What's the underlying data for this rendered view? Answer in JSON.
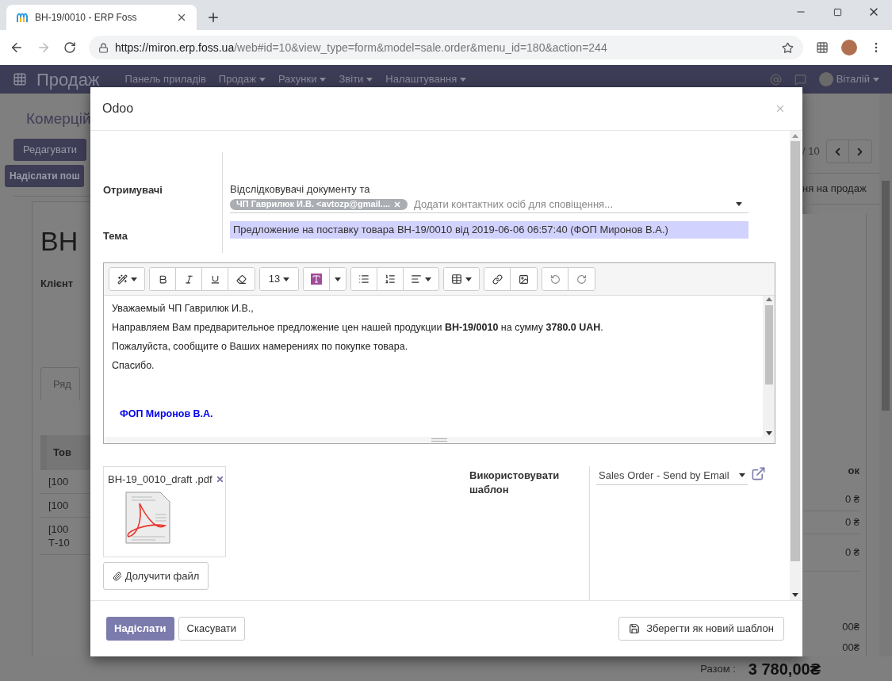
{
  "browser": {
    "tab_title": "ВН-19/0010 - ERP Foss",
    "url_host": "https://miron.erp.foss.ua",
    "url_path": "/web#id=10&view_type=form&model=sale.order&menu_id=180&action=244"
  },
  "navbar": {
    "app": "Продаж",
    "menu": [
      {
        "label": "Панель приладів",
        "has_menu": false
      },
      {
        "label": "Продаж",
        "has_menu": true
      },
      {
        "label": "Рахунки",
        "has_menu": true
      },
      {
        "label": "Звіти",
        "has_menu": true
      },
      {
        "label": "Налаштування",
        "has_menu": true
      }
    ],
    "user": "Віталій"
  },
  "background": {
    "breadcrumb": "Комерцій",
    "edit_button": "Редагувати",
    "send_button": "Надіслати пош",
    "pager": "/ 10",
    "status": "ня на продаж",
    "record_title": "ВН",
    "customer_label": "Клієнт",
    "tab": "Ряд",
    "col_left": "Тов",
    "col_right": "ок",
    "rows": [
      {
        "left": [
          "[100"
        ],
        "right": "0 ₴"
      },
      {
        "left": [
          "[100"
        ],
        "right": "0 ₴"
      },
      {
        "left": [
          "[100",
          "Т-10"
        ],
        "right": "0 ₴"
      }
    ],
    "subtotals": [
      "00₴",
      "00₴"
    ],
    "total_label": "Разом :",
    "total_value": "3 780,00₴"
  },
  "dialog": {
    "title": "Odoo",
    "recipients_label": "Отримувачі",
    "recipients_text": "Відслідковувачі документу та",
    "recipient_tags": [
      "ЧП Гаврилюк И.В. <avtozp@gmail...."
    ],
    "recipients_placeholder": "Додати контактних осіб для сповіщення...",
    "subject_label": "Тема",
    "subject": "Предложение на поставку товара ВН-19/0010 від 2019-06-06 06:57:40 (ФОП Миронов В.А.)",
    "font_size": "13",
    "body": [
      "Уважаемый ЧП Гаврилюк И.В.,",
      "Направляем Вам предварительное предложение цен нашей продукции **ВН-19/0010** на сумму **3780.0 UAH**.",
      "Пожалуйста, сообщите о Ваших намерениях по покупке товара.",
      "Спасибо."
    ],
    "signature": "ФОП Миронов В.А.",
    "attachments": [
      "ВН-19_0010_draft .pdf"
    ],
    "attach_button": "Долучити файл",
    "template_label": "Використовувати шаблон",
    "template": "Sales Order - Send by Email",
    "send_button": "Надіслати",
    "cancel_button": "Скасувати",
    "save_template_button": "Зберегти як новий шаблон"
  }
}
